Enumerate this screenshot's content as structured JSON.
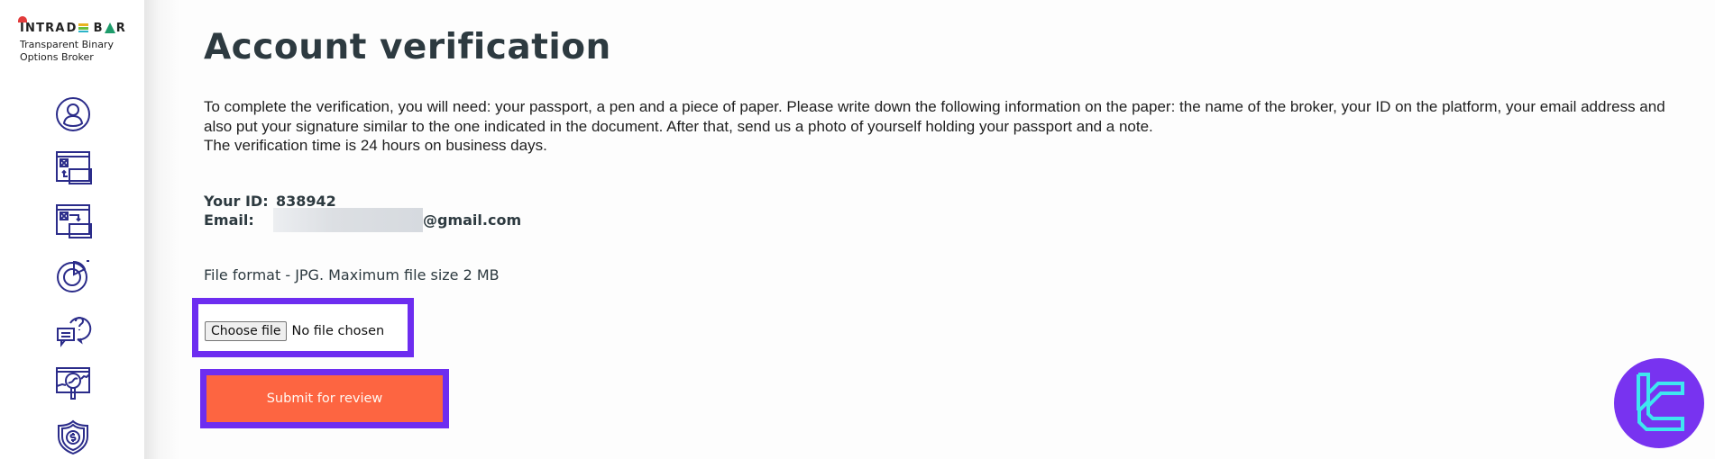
{
  "brand": {
    "logo_text": "INTRADE BAR",
    "tagline": "Transparent Binary Options Broker"
  },
  "sidebar": {
    "items": [
      {
        "name": "profile",
        "icon": "user-circle-icon"
      },
      {
        "name": "deposit",
        "icon": "wallet-deposit-icon"
      },
      {
        "name": "withdrawal",
        "icon": "wallet-withdraw-icon"
      },
      {
        "name": "statistics",
        "icon": "pie-chart-icon"
      },
      {
        "name": "support",
        "icon": "chat-question-icon"
      },
      {
        "name": "analytics",
        "icon": "chart-magnifier-icon"
      },
      {
        "name": "security",
        "icon": "shield-dollar-icon"
      }
    ]
  },
  "page": {
    "title": "Account verification",
    "description": [
      "To complete the verification, you will need: your passport, a pen and a piece of paper. Please write down the following information on the paper: the name of the broker, your ID on the platform, your email address and also put your signature similar to the one indicated in the document. After that, send us a photo of yourself holding your passport and a note.",
      "The verification time is 24 hours on business days."
    ],
    "id_label": "Your ID:",
    "id_value": "838942",
    "email_label": "Email:",
    "email_value_visible": "@gmail.com",
    "file_note": "File format - JPG. Maximum file size 2 MB",
    "choose_file_label": "Choose file",
    "no_file_label": "No file chosen",
    "submit_label": "Submit for review"
  },
  "colors": {
    "accent_highlight": "#6d2df0",
    "submit_button": "#fd6541",
    "icon_stroke": "#2b2c8a",
    "badge_bg": "#7833f0",
    "badge_fg": "#3ee6f0"
  }
}
